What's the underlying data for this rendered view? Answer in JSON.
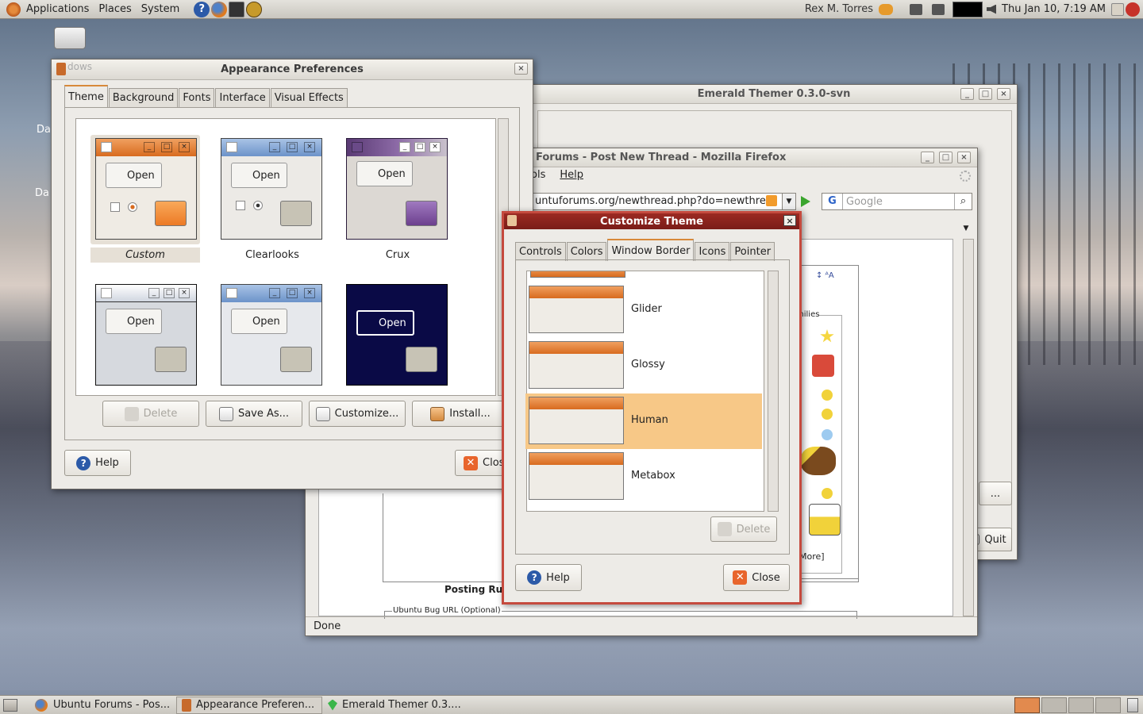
{
  "top_panel": {
    "applications": "Applications",
    "places": "Places",
    "system": "System",
    "user": "Rex M. Torres",
    "clock": "Thu Jan 10,  7:19 AM"
  },
  "desktop": {
    "side_text_1": "Da",
    "side_text_2": "Da",
    "bg_window_fragment": "dows"
  },
  "appearance": {
    "title": "Appearance Preferences",
    "tabs": [
      "Theme",
      "Background",
      "Fonts",
      "Interface",
      "Visual Effects"
    ],
    "themes": [
      "Custom",
      "Clearlooks",
      "Crux",
      "",
      "",
      ""
    ],
    "open_label": "Open",
    "buttons": {
      "delete": "Delete",
      "save_as": "Save As...",
      "customize": "Customize...",
      "install": "Install...",
      "help": "Help",
      "close": "Clos"
    }
  },
  "emerald": {
    "title": "Emerald Themer 0.3.0-svn",
    "quit": "Quit",
    "ellipsis": "..."
  },
  "firefox": {
    "title": "Forums - Post New Thread - Mozilla Firefox",
    "menu_tools": "ols",
    "menu_help": "Help",
    "url": "untuforums.org/newthread.php?do=newthrea",
    "search_placeholder": "Google",
    "status": "Done",
    "posting_rules": "Posting Rules",
    "bug_url_label": "Ubuntu Bug URL (Optional)",
    "smilies_label": "milies",
    "more": "More]"
  },
  "customize": {
    "title": "Customize Theme",
    "tabs": [
      "Controls",
      "Colors",
      "Window Border",
      "Icons",
      "Pointer"
    ],
    "borders": [
      "Glider",
      "Glossy",
      "Human",
      "Metabox"
    ],
    "delete": "Delete",
    "help": "Help",
    "close": "Close"
  },
  "taskbar": [
    {
      "label": "Ubuntu Forums - Pos..."
    },
    {
      "label": "Appearance Preferen..."
    },
    {
      "label": "Emerald Themer 0.3...."
    }
  ]
}
